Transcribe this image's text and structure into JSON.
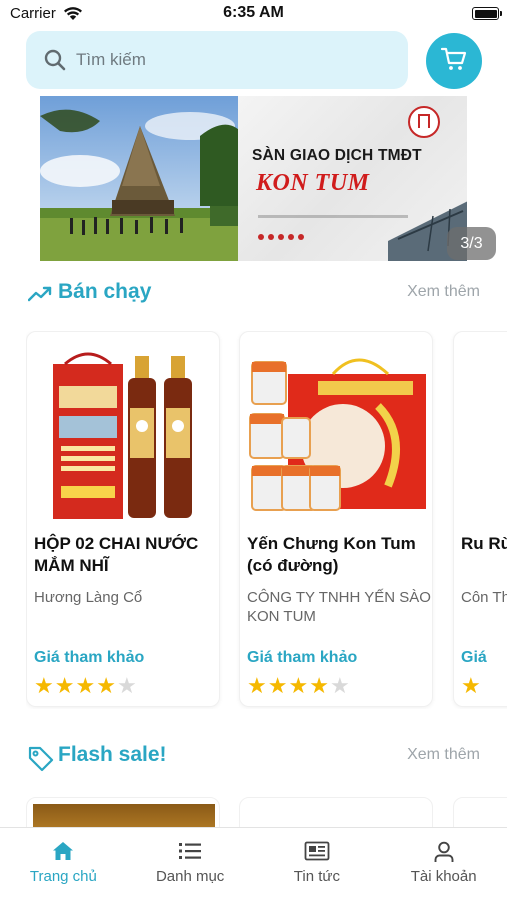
{
  "status_bar": {
    "carrier": "Carrier",
    "time": "6:35 AM",
    "battery_level": 1.0
  },
  "search": {
    "placeholder": "Tìm kiếm",
    "icon": "search-icon"
  },
  "cart": {
    "icon": "cart-icon"
  },
  "banner": {
    "title": "SÀN GIAO DỊCH TMĐT",
    "subtitle": "KON TUM",
    "counter": "3/3"
  },
  "best_sellers": {
    "title": "Bán chạy",
    "icon": "trending-up-icon",
    "see_more": "Xem thêm",
    "products": [
      {
        "name": "HỘP 02 CHAI NƯỚC MẮM NHĨ",
        "seller": "Hương Làng Cổ",
        "price": "Giá tham khảo",
        "rating": 4
      },
      {
        "name": "Yến Chưng Kon Tum (có đường)",
        "seller": "CÔNG TY TNHH YẾN SÀO KON TUM",
        "price": "Giá tham khảo",
        "rating": 4
      },
      {
        "name": "Ru Rù",
        "seller": "Côn Thi",
        "price": "Giá",
        "rating": 1
      }
    ]
  },
  "flash_sale": {
    "title": "Flash sale!",
    "icon": "tag-icon",
    "see_more": "Xem thêm"
  },
  "tab_bar": {
    "active": "home",
    "items": [
      {
        "id": "home",
        "label": "Trang chủ",
        "icon": "home-icon"
      },
      {
        "id": "categories",
        "label": "Danh mục",
        "icon": "list-icon"
      },
      {
        "id": "news",
        "label": "Tin tức",
        "icon": "newspaper-icon"
      },
      {
        "id": "account",
        "label": "Tài khoản",
        "icon": "user-icon"
      }
    ]
  },
  "colors": {
    "accent": "#2aa6c3",
    "cart_button": "#2bb7d4",
    "search_bg": "#dcf3fa",
    "star": "#f5b800",
    "star_empty": "#d9d9d9",
    "muted": "#9ea5aa"
  }
}
